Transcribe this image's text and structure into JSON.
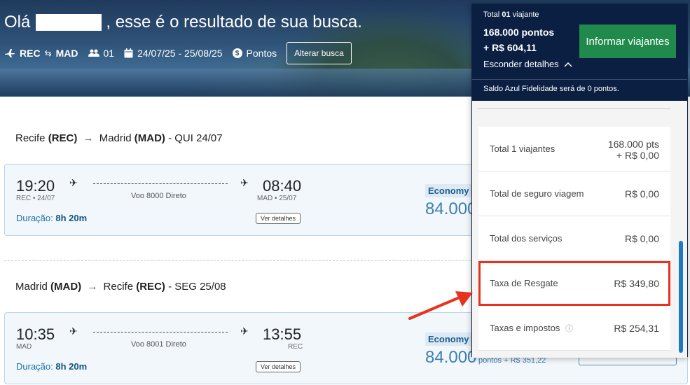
{
  "header": {
    "greeting_prefix": "Olá",
    "greeting_suffix": ", esse é o resultado de sua busca.",
    "origin": "REC",
    "destination": "MAD",
    "passengers": "01",
    "dates": "24/07/25 - 25/08/25",
    "currency_mode": "Pontos",
    "change_search_label": "Alterar busca"
  },
  "flights": [
    {
      "route_origin_city": "Recife",
      "route_origin_code": "(REC)",
      "route_dest_city": "Madrid",
      "route_dest_code": "(MAD)",
      "route_date": "- QUI 24/07",
      "depart_time": "19:20",
      "depart_info": "REC • 24/07",
      "arrive_time": "08:40",
      "arrive_info": "MAD • 25/07",
      "flight_label": "Voo 8000 Direto",
      "duration_label": "Duração:",
      "duration_value": "8h 20m",
      "details_label": "Ver detalhes",
      "fare_class": "Economy",
      "points": "84.000",
      "points_suffix": ""
    },
    {
      "route_origin_city": "Madrid",
      "route_origin_code": "(MAD)",
      "route_dest_city": "Recife",
      "route_dest_code": "(REC)",
      "route_date": "- SEG 25/08",
      "depart_time": "10:35",
      "depart_info": "MAD",
      "arrive_time": "13:55",
      "arrive_info": "REC",
      "flight_label": "Voo 8001 Direto",
      "duration_label": "Duração:",
      "duration_value": "8h 20m",
      "details_label": "Ver detalhes",
      "fare_class": "Economy",
      "points": "84.000",
      "points_suffix": "pontos + R$ 351,22"
    }
  ],
  "panel": {
    "total_label": "Total",
    "total_count": "01",
    "total_unit": "viajante",
    "points_line": "168.000 pontos",
    "money_line": "+ R$ 604,11",
    "inform_button": "Informar viajantes",
    "hide_details": "Esconder detalhes",
    "saldo_text": "Saldo Azul Fidelidade será de 0 pontos.",
    "rows": [
      {
        "label": "Total 1 viajantes",
        "value": "168.000 pts",
        "value2": "+ R$ 0,00"
      },
      {
        "label": "Total de seguro viagem",
        "value": "R$ 0,00"
      },
      {
        "label": "Total dos serviços",
        "value": "R$ 0,00"
      },
      {
        "label": "Taxa de Resgate",
        "value": "R$ 349,80"
      },
      {
        "label": "Taxas e impostos",
        "value": "R$ 254,31"
      }
    ]
  },
  "colors": {
    "accent_green": "#1f8a4c",
    "panel_navy": "#0b1f43",
    "highlight_red": "#e8321f",
    "link_blue": "#1a6fa5"
  }
}
